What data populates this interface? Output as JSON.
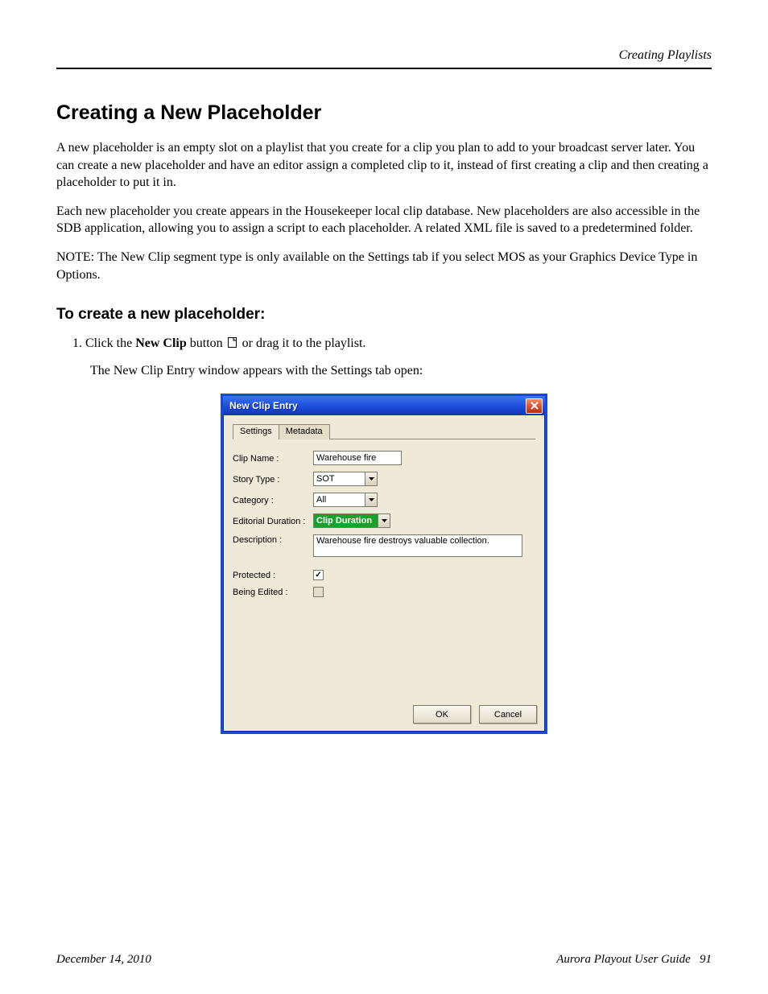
{
  "header": {
    "running": "Creating Playlists"
  },
  "section": {
    "h1": "Creating a New Placeholder",
    "p1": "A new placeholder is an empty slot on a playlist that you create for a clip you plan to add to your broadcast server later. You can create a new placeholder and have an editor assign a completed clip to it, instead of first creating a clip and then creating a placeholder to put it in.",
    "p2": "Each new placeholder you create appears in the Housekeeper local clip database. New placeholders are also accessible in the SDB application, allowing you to assign a script to each placeholder. A related XML file is saved to a predetermined folder.",
    "note": "NOTE: The New Clip segment type is only available on the Settings tab if you select MOS as your Graphics Device Type in Options.",
    "h2": "To create a new placeholder:",
    "step1_pre": "1. Click the ",
    "step1_bold": "New Clip",
    "step1_post": " button ",
    "step1_tail": " or drag it to the playlist.",
    "step2": "The New Clip Entry window appears with the Settings tab open:"
  },
  "dialog": {
    "title": "New Clip Entry",
    "tabs": {
      "settings": "Settings",
      "metadata": "Metadata"
    },
    "labels": {
      "clipName": "Clip Name :",
      "storyType": "Story Type :",
      "category": "Category :",
      "editorial": "Editorial Duration :",
      "description": "Description :",
      "protected": "Protected :",
      "beingEdited": "Being Edited :"
    },
    "values": {
      "clipName": "Warehouse fire",
      "storyType": "SOT",
      "category": "All",
      "editorial": "Clip Duration",
      "description": "Warehouse fire destroys valuable collection.",
      "protected": true,
      "beingEdited": false
    },
    "buttons": {
      "ok": "OK",
      "cancel": "Cancel"
    }
  },
  "footer": {
    "date": "December 14, 2010",
    "product": "Aurora Playout User Guide",
    "page": "91"
  }
}
